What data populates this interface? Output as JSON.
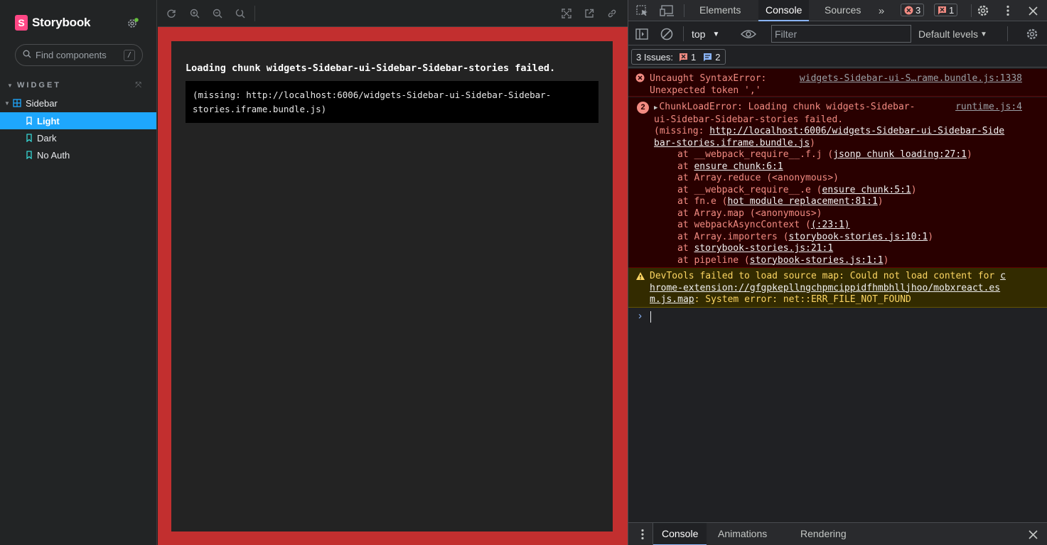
{
  "storybook": {
    "brand": "Storybook",
    "search": {
      "placeholder": "Find components",
      "shortcut": "/"
    },
    "section": "WIDGET",
    "tree": [
      {
        "label": "Sidebar",
        "kind": "component"
      },
      {
        "label": "Light",
        "kind": "story",
        "selected": true
      },
      {
        "label": "Dark",
        "kind": "story"
      },
      {
        "label": "No Auth",
        "kind": "story"
      }
    ],
    "preview": {
      "title": "Loading chunk widgets-Sidebar-ui-Sidebar-Sidebar-stories failed.",
      "missing_line1": "(missing: http://localhost:6006/widgets-Sidebar-ui-Sidebar-Sidebar-",
      "missing_line2": "stories.iframe.bundle.js)"
    }
  },
  "devtools": {
    "tabs": [
      "Elements",
      "Console",
      "Sources"
    ],
    "active_tab": "Console",
    "error_count": "3",
    "issue_count": "1",
    "context": "top",
    "filter_placeholder": "Filter",
    "levels": "Default levels",
    "issues_label": "3 Issues:",
    "issues_errors": "1",
    "issues_info": "2",
    "messages": {
      "syntax": {
        "line1": "Uncaught SyntaxError:",
        "line2": "Unexpected token ','",
        "source": "widgets-Sidebar-ui-S…rame.bundle.js:1338"
      },
      "chunk": {
        "count": "2",
        "line1": "ChunkLoadError: Loading chunk widgets-Sidebar-",
        "line2": "ui-Sidebar-Sidebar-stories failed.",
        "source": "runtime.js:4",
        "missing_prefix": "(missing: ",
        "missing_url1": "http://localhost:6006/widgets-Sidebar-ui-Sidebar-Side",
        "missing_url2": "bar-stories.iframe.bundle.js",
        "missing_suffix": ")",
        "stack": [
          {
            "pre": "at __webpack_require__.f.j (",
            "link": "jsonp chunk loading:27:1",
            "post": ")"
          },
          {
            "pre": "at ",
            "link": "ensure chunk:6:1",
            "post": ""
          },
          {
            "pre": "at Array.reduce (<anonymous>)",
            "link": "",
            "post": ""
          },
          {
            "pre": "at __webpack_require__.e (",
            "link": "ensure chunk:5:1",
            "post": ")"
          },
          {
            "pre": "at fn.e (",
            "link": "hot module replacement:81:1",
            "post": ")"
          },
          {
            "pre": "at Array.map (<anonymous>)",
            "link": "",
            "post": ""
          },
          {
            "pre": "at webpackAsyncContext (",
            "link": "(:23:1)",
            "post": ""
          },
          {
            "pre": "at Array.importers (",
            "link": "storybook-stories.js:10:1",
            "post": ")"
          },
          {
            "pre": "at ",
            "link": "storybook-stories.js:21:1",
            "post": ""
          },
          {
            "pre": "at pipeline (",
            "link": "storybook-stories.js:1:1",
            "post": ")"
          }
        ]
      },
      "warning": {
        "prefix": "DevTools failed to load source map: Could not load content for ",
        "link_c": "c",
        "link_rest1": "hrome-extension://gfgpkepllngchpmcippidfhmbhlljhoo/mobxreact.es",
        "link_rest2": "m.js.map",
        "suffix": ": System error: net::ERR_FILE_NOT_FOUND"
      }
    },
    "drawer_tabs": [
      "Console",
      "Animations",
      "Rendering"
    ]
  },
  "colors": {
    "storybook_accent": "#ff4785",
    "selected": "#1ea7fd",
    "preview_border": "#c22f2f"
  }
}
